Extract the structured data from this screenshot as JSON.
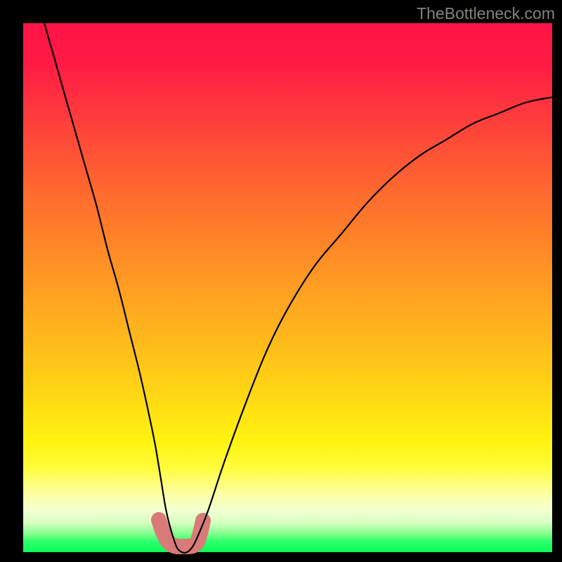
{
  "watermark": "TheBottleneck.com",
  "chart_data": {
    "type": "line",
    "title": "",
    "xlabel": "",
    "ylabel": "",
    "xlim": [
      0,
      100
    ],
    "ylim": [
      0,
      100
    ],
    "grid": false,
    "legend": false,
    "series": [
      {
        "name": "bottleneck-curve",
        "x": [
          4,
          6,
          8,
          10,
          12,
          14,
          16,
          18,
          20,
          22,
          24,
          25,
          26,
          27,
          28,
          29,
          30,
          31,
          32,
          33,
          35,
          38,
          42,
          46,
          50,
          55,
          60,
          65,
          70,
          75,
          80,
          85,
          90,
          95,
          100
        ],
        "values": [
          100,
          93,
          86,
          79,
          72,
          65,
          57,
          50,
          42,
          34,
          25,
          20,
          14,
          8,
          4,
          1,
          0,
          0,
          1,
          3,
          8,
          17,
          28,
          38,
          46,
          54,
          60,
          66,
          71,
          75,
          78,
          81,
          83,
          85,
          86
        ]
      }
    ],
    "annotations": [
      {
        "name": "valley-marker",
        "x_range": [
          27,
          33
        ],
        "y": 0
      }
    ],
    "background_gradient": {
      "direction": "vertical",
      "stops": [
        {
          "pos": 0.0,
          "color": "#ff1448"
        },
        {
          "pos": 0.32,
          "color": "#ff6a2e"
        },
        {
          "pos": 0.7,
          "color": "#ffd614"
        },
        {
          "pos": 0.89,
          "color": "#fcffa4"
        },
        {
          "pos": 1.0,
          "color": "#0aff59"
        }
      ]
    }
  }
}
